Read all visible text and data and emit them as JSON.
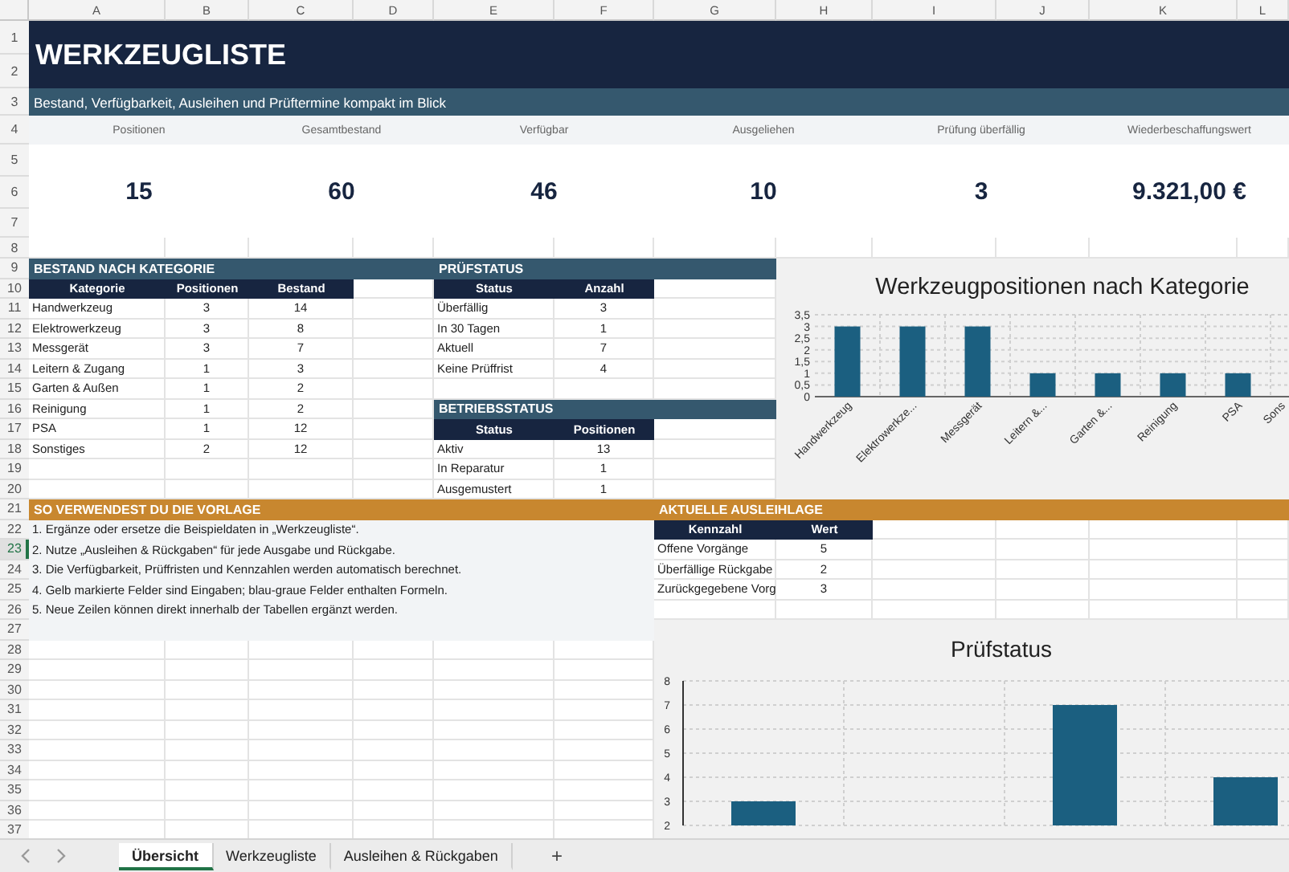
{
  "column_headers": [
    "A",
    "B",
    "C",
    "D",
    "E",
    "F",
    "G",
    "H",
    "I",
    "J",
    "K",
    "L"
  ],
  "row_headers": [
    {
      "label": "1",
      "selected": false
    },
    {
      "label": "2",
      "selected": false
    },
    {
      "label": "3",
      "selected": false
    },
    {
      "label": "4",
      "selected": false
    },
    {
      "label": "5",
      "selected": false
    },
    {
      "label": "6",
      "selected": false
    },
    {
      "label": "7",
      "selected": false
    },
    {
      "label": "8",
      "selected": false
    },
    {
      "label": "9",
      "selected": false
    },
    {
      "label": "10",
      "selected": false
    },
    {
      "label": "11",
      "selected": false
    },
    {
      "label": "12",
      "selected": false
    },
    {
      "label": "13",
      "selected": false
    },
    {
      "label": "14",
      "selected": false
    },
    {
      "label": "15",
      "selected": false
    },
    {
      "label": "16",
      "selected": false
    },
    {
      "label": "17",
      "selected": false
    },
    {
      "label": "18",
      "selected": false
    },
    {
      "label": "19",
      "selected": false
    },
    {
      "label": "20",
      "selected": false
    },
    {
      "label": "21",
      "selected": false
    },
    {
      "label": "22",
      "selected": false
    },
    {
      "label": "23",
      "selected": true
    },
    {
      "label": "24",
      "selected": false
    },
    {
      "label": "25",
      "selected": false
    },
    {
      "label": "26",
      "selected": false
    },
    {
      "label": "27",
      "selected": false
    },
    {
      "label": "28",
      "selected": false
    },
    {
      "label": "29",
      "selected": false
    },
    {
      "label": "30",
      "selected": false
    },
    {
      "label": "31",
      "selected": false
    },
    {
      "label": "32",
      "selected": false
    },
    {
      "label": "33",
      "selected": false
    },
    {
      "label": "34",
      "selected": false
    },
    {
      "label": "35",
      "selected": false
    },
    {
      "label": "36",
      "selected": false
    },
    {
      "label": "37",
      "selected": false
    }
  ],
  "title": "WERKZEUGLISTE",
  "subtitle": "Bestand, Verfügbarkeit, Ausleihen und Prüftermine kompakt im Blick",
  "kpis": [
    {
      "label": "Positionen",
      "value": "15"
    },
    {
      "label": "Gesamtbestand",
      "value": "60"
    },
    {
      "label": "Verfügbar",
      "value": "46"
    },
    {
      "label": "Ausgeliehen",
      "value": "10"
    },
    {
      "label": "Prüfung überfällig",
      "value": "3"
    },
    {
      "label": "Wiederbeschaffungswert",
      "value": "9.321,00 €"
    }
  ],
  "category_table": {
    "title": "BESTAND NACH KATEGORIE",
    "columns": [
      "Kategorie",
      "Positionen",
      "Bestand"
    ],
    "rows": [
      [
        "Handwerkzeug",
        "3",
        "14"
      ],
      [
        "Elektrowerkzeug",
        "3",
        "8"
      ],
      [
        "Messgerät",
        "3",
        "7"
      ],
      [
        "Leitern & Zugang",
        "1",
        "3"
      ],
      [
        "Garten & Außen",
        "1",
        "2"
      ],
      [
        "Reinigung",
        "1",
        "2"
      ],
      [
        "PSA",
        "1",
        "12"
      ],
      [
        "Sonstiges",
        "2",
        "12"
      ]
    ]
  },
  "inspection_table": {
    "title": "PRÜFSTATUS",
    "columns": [
      "Status",
      "Anzahl"
    ],
    "rows": [
      [
        "Überfällig",
        "3"
      ],
      [
        "In 30 Tagen",
        "1"
      ],
      [
        "Aktuell",
        "7"
      ],
      [
        "Keine Prüffrist",
        "4"
      ]
    ]
  },
  "operating_table": {
    "title": "BETRIEBSSTATUS",
    "columns": [
      "Status",
      "Positionen"
    ],
    "rows": [
      [
        "Aktiv",
        "13"
      ],
      [
        "In Reparatur",
        "1"
      ],
      [
        "Ausgemustert",
        "1"
      ]
    ]
  },
  "category_chart": {
    "chart_data": {
      "type": "bar",
      "title": "Werkzeugpositionen nach Kategorie",
      "categories": [
        "Handwerkzeug",
        "Elektrowerkze...",
        "Messgerät",
        "Leitern &...",
        "Garten &...",
        "Reinigung",
        "PSA",
        "Sons"
      ],
      "values": [
        3,
        3,
        3,
        1,
        1,
        1,
        1,
        null
      ],
      "grid": true,
      "ylim": [
        0,
        3.5
      ],
      "yticks": [
        0,
        {
          "value": 0.5,
          "label": "0,5"
        },
        1,
        {
          "value": 1.5,
          "label": "1,5"
        },
        2,
        {
          "value": 2.5,
          "label": "2,5"
        },
        3,
        {
          "value": 3.5,
          "label": "3,5"
        }
      ]
    }
  },
  "instructions": {
    "title": "SO VERWENDEST DU DIE VORLAGE",
    "lines": [
      "1. Ergänze oder ersetze die Beispieldaten in „Werkzeugliste“.",
      "2. Nutze „Ausleihen & Rückgaben“ für jede Ausgabe und Rückgabe.",
      "3. Die Verfügbarkeit, Prüffristen und Kennzahlen werden automatisch berechnet.",
      "4. Gelb markierte Felder sind Eingaben; blau-graue Felder enthalten Formeln.",
      "5. Neue Zeilen können direkt innerhalb der Tabellen ergänzt werden."
    ]
  },
  "loan_table": {
    "title": "AKTUELLE AUSLEIHLAGE",
    "columns": [
      "Kennzahl",
      "Wert"
    ],
    "rows": [
      [
        "Offene Vorgänge",
        "5"
      ],
      [
        "Überfällige Rückgabe",
        "2"
      ],
      [
        "Zurückgegebene Vorg",
        "3"
      ]
    ]
  },
  "inspection_chart": {
    "chart_data": {
      "type": "bar",
      "title": "Prüfstatus",
      "values": [
        3,
        null,
        7,
        4
      ],
      "grid": true,
      "ylim": [
        2,
        8
      ],
      "yticks": [
        2,
        3,
        4,
        5,
        6,
        7,
        8
      ]
    }
  },
  "sheet_tabs": [
    {
      "label": "Übersicht",
      "selected": true
    },
    {
      "label": "Werkzeugliste",
      "selected": false
    },
    {
      "label": "Ausleihen & Rückgaben",
      "selected": false
    }
  ],
  "add_sheet": "+"
}
